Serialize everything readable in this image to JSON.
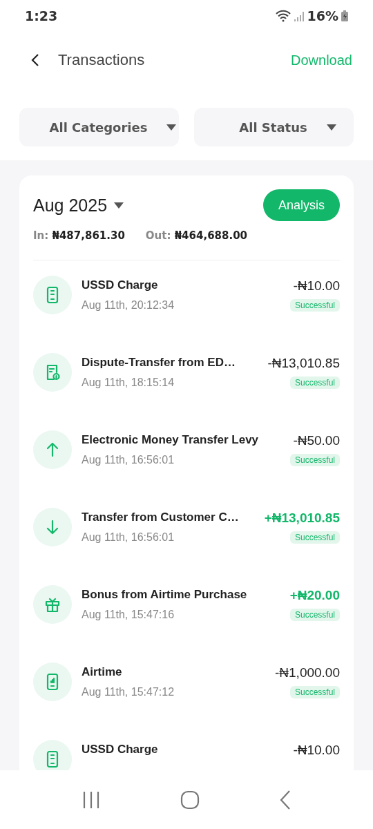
{
  "status_bar": {
    "time": "1:23",
    "battery": "16%"
  },
  "header": {
    "title": "Transactions",
    "action": "Download"
  },
  "filters": [
    {
      "label": "All Categories"
    },
    {
      "label": "All Status"
    }
  ],
  "summary": {
    "month": "Aug 2025",
    "button": "Analysis",
    "in_label": "In:",
    "in_value": "₦487,861.30",
    "out_label": "Out:",
    "out_value": "₦464,688.00"
  },
  "transactions": [
    {
      "kind": "ussd",
      "title": "USSD Charge",
      "date": "Aug 11th, 20:12:34",
      "amount": "-₦10.00",
      "credit": false,
      "status": "Successful"
    },
    {
      "kind": "document",
      "title": "Dispute-Transfer from ED…",
      "date": "Aug 11th, 18:15:14",
      "amount": "-₦13,010.85",
      "credit": false,
      "status": "Successful"
    },
    {
      "kind": "up",
      "title": "Electronic Money Transfer Levy",
      "date": "Aug 11th, 16:56:01",
      "amount": "-₦50.00",
      "credit": false,
      "status": "Successful"
    },
    {
      "kind": "down",
      "title": "Transfer from Customer C…",
      "date": "Aug 11th, 16:56:01",
      "amount": "+₦13,010.85",
      "credit": true,
      "status": "Successful"
    },
    {
      "kind": "gift",
      "title": "Bonus from Airtime Purchase",
      "date": "Aug 11th, 15:47:16",
      "amount": "+₦20.00",
      "credit": true,
      "status": "Successful"
    },
    {
      "kind": "airtime",
      "title": "Airtime",
      "date": "Aug 11th, 15:47:12",
      "amount": "-₦1,000.00",
      "credit": false,
      "status": "Successful"
    },
    {
      "kind": "ussd",
      "title": "USSD Charge",
      "amount": "-₦10.00",
      "credit": false
    }
  ]
}
